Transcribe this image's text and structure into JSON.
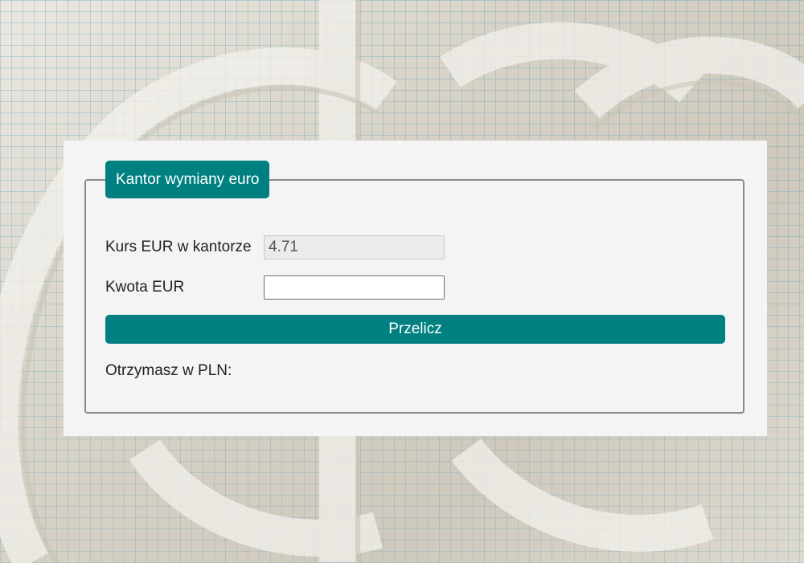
{
  "form": {
    "legend": "Kantor wymiany euro",
    "rate_label": "Kurs EUR w kantorze",
    "rate_value": "4.71",
    "amount_label": "Kwota EUR",
    "amount_value": "",
    "button_label": "Przelicz",
    "result_label": "Otrzymasz w PLN:"
  },
  "colors": {
    "accent": "#008080",
    "panel_background": "#f4f4f4",
    "fieldset_border": "#8a8a8a"
  }
}
